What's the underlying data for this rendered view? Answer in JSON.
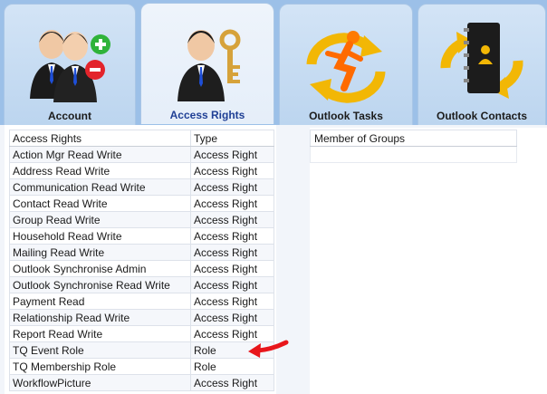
{
  "tabs": [
    {
      "label": "Account",
      "icon": "users-add-remove-icon",
      "active": false
    },
    {
      "label": "Access Rights",
      "icon": "user-key-icon",
      "active": true
    },
    {
      "label": "Outlook Tasks",
      "icon": "task-sync-icon",
      "active": false
    },
    {
      "label": "Outlook Contacts",
      "icon": "contacts-sync-icon",
      "active": false
    }
  ],
  "access_rights": {
    "headers": [
      "Access Rights",
      "Type"
    ],
    "rows": [
      [
        "Action Mgr Read Write",
        "Access Right"
      ],
      [
        "Address Read Write",
        "Access Right"
      ],
      [
        "Communication Read Write",
        "Access Right"
      ],
      [
        "Contact Read Write",
        "Access Right"
      ],
      [
        "Group Read Write",
        "Access Right"
      ],
      [
        "Household Read Write",
        "Access Right"
      ],
      [
        "Mailing Read Write",
        "Access Right"
      ],
      [
        "Outlook Synchronise Admin",
        "Access Right"
      ],
      [
        "Outlook Synchronise Read Write",
        "Access Right"
      ],
      [
        "Payment Read",
        "Access Right"
      ],
      [
        "Relationship Read Write",
        "Access Right"
      ],
      [
        "Report Read Write",
        "Access Right"
      ],
      [
        "TQ Event Role",
        "Role"
      ],
      [
        "TQ Membership Role",
        "Role"
      ],
      [
        "WorkflowPicture",
        "Access Right"
      ]
    ]
  },
  "member_of_groups": {
    "header": "Member of Groups"
  },
  "colors": {
    "background": "#9cc0e8",
    "active_tab_text": "#1f3f95",
    "annotation_arrow": "#e8161b"
  }
}
